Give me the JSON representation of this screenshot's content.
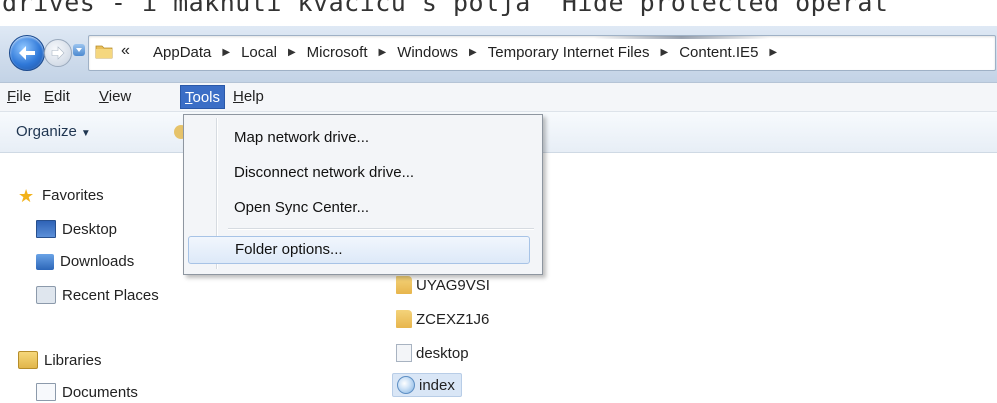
{
  "top_text": "drives - i maknuti kvačicu s polja \"Hide protected operat",
  "address": {
    "overflow": "«",
    "crumbs": [
      "AppData",
      "Local",
      "Microsoft",
      "Windows",
      "Temporary Internet Files",
      "Content.IE5"
    ],
    "separator": "▶"
  },
  "menubar": {
    "file": {
      "underline": "F",
      "rest": "ile"
    },
    "edit": {
      "underline": "E",
      "rest": "dit"
    },
    "view": {
      "underline": "V",
      "rest": "iew"
    },
    "tools": {
      "underline": "T",
      "rest": "ools"
    },
    "help": {
      "underline": "H",
      "rest": "elp"
    }
  },
  "toolbar": {
    "organize": "Organize",
    "caret": "▼"
  },
  "nav": {
    "favorites": "Favorites",
    "desktop": "Desktop",
    "downloads": "Downloads",
    "recent": "Recent Places",
    "libraries": "Libraries",
    "documents": "Documents"
  },
  "files": {
    "f1": "UYAG9VSI",
    "f2": "ZCEXZ1J6",
    "f3": "desktop",
    "f4": "index"
  },
  "tools_menu": {
    "map": "Map network drive...",
    "disconnect": "Disconnect network drive...",
    "sync": "Open Sync Center...",
    "folder_options": "Folder options..."
  },
  "icons": {
    "back": "back-arrow-icon",
    "forward": "forward-arrow-icon",
    "star": "★"
  },
  "colors": {
    "menu_active": "#3b6ec6",
    "hover_border": "#a7c3e6"
  }
}
